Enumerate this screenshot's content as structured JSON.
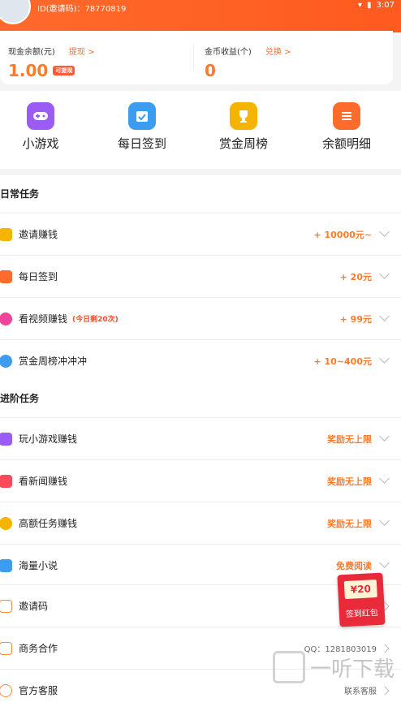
{
  "status_bar": {
    "id_text": "ID(邀请码)：78770819",
    "time": "3:07"
  },
  "wallet": {
    "cash_label": "现金余额(元)",
    "cash_link": "提现 >",
    "cash_value": "1.00",
    "cash_badge": "可提现",
    "coin_label": "金币收益(个)",
    "coin_link": "兑换 >",
    "coin_value": "0"
  },
  "quick_actions": [
    {
      "label": "小游戏",
      "icon": "gamepad-icon",
      "color": "#9b5cf6"
    },
    {
      "label": "每日签到",
      "icon": "calendar-check-icon",
      "color": "#3b9cf0"
    },
    {
      "label": "赏金周榜",
      "icon": "trophy-icon",
      "color": "#f5b400"
    },
    {
      "label": "余额明细",
      "icon": "list-icon",
      "color": "#ff6b2b"
    }
  ],
  "daily": {
    "title": "日常任务",
    "rows": [
      {
        "label": "邀请赚钱",
        "note": "",
        "reward": "+ 10000元~",
        "icon": "invite-icon",
        "color": "#f5b400"
      },
      {
        "label": "每日签到",
        "note": "",
        "reward": "+ 20元",
        "icon": "calendar-icon",
        "color": "#ff6b2b"
      },
      {
        "label": "看视频赚钱",
        "note": "(今日剩20次)",
        "reward": "+ 99元",
        "icon": "play-icon",
        "color": "#f0449a"
      },
      {
        "label": "赏金周榜冲冲冲",
        "note": "",
        "reward": "+ 10~400元",
        "icon": "alarm-icon",
        "color": "#3b9cf0"
      }
    ]
  },
  "advanced": {
    "title": "进阶任务",
    "rows": [
      {
        "label": "玩小游戏赚钱",
        "reward": "奖励无上限",
        "icon": "gamepad-icon",
        "color": "#9b5cf6"
      },
      {
        "label": "看新闻赚钱",
        "reward": "奖励无上限",
        "icon": "news-icon",
        "color": "#ff4a5a"
      },
      {
        "label": "高额任务赚钱",
        "reward": "奖励无上限",
        "icon": "pacman-icon",
        "color": "#f5b400"
      },
      {
        "label": "海量小说",
        "reward": "免费阅读",
        "icon": "book-icon",
        "color": "#3b9cf0"
      }
    ]
  },
  "misc": {
    "rows": [
      {
        "label": "邀请码",
        "value": "",
        "icon": "chat-icon"
      },
      {
        "label": "商务合作",
        "value": "QQ：1281803019",
        "icon": "briefcase-icon"
      },
      {
        "label": "官方客服",
        "value": "联系客服",
        "icon": "headset-icon"
      }
    ]
  },
  "red_packet": {
    "amount": "¥20",
    "label": "签到红包"
  },
  "watermark": {
    "text": "一听下载"
  }
}
